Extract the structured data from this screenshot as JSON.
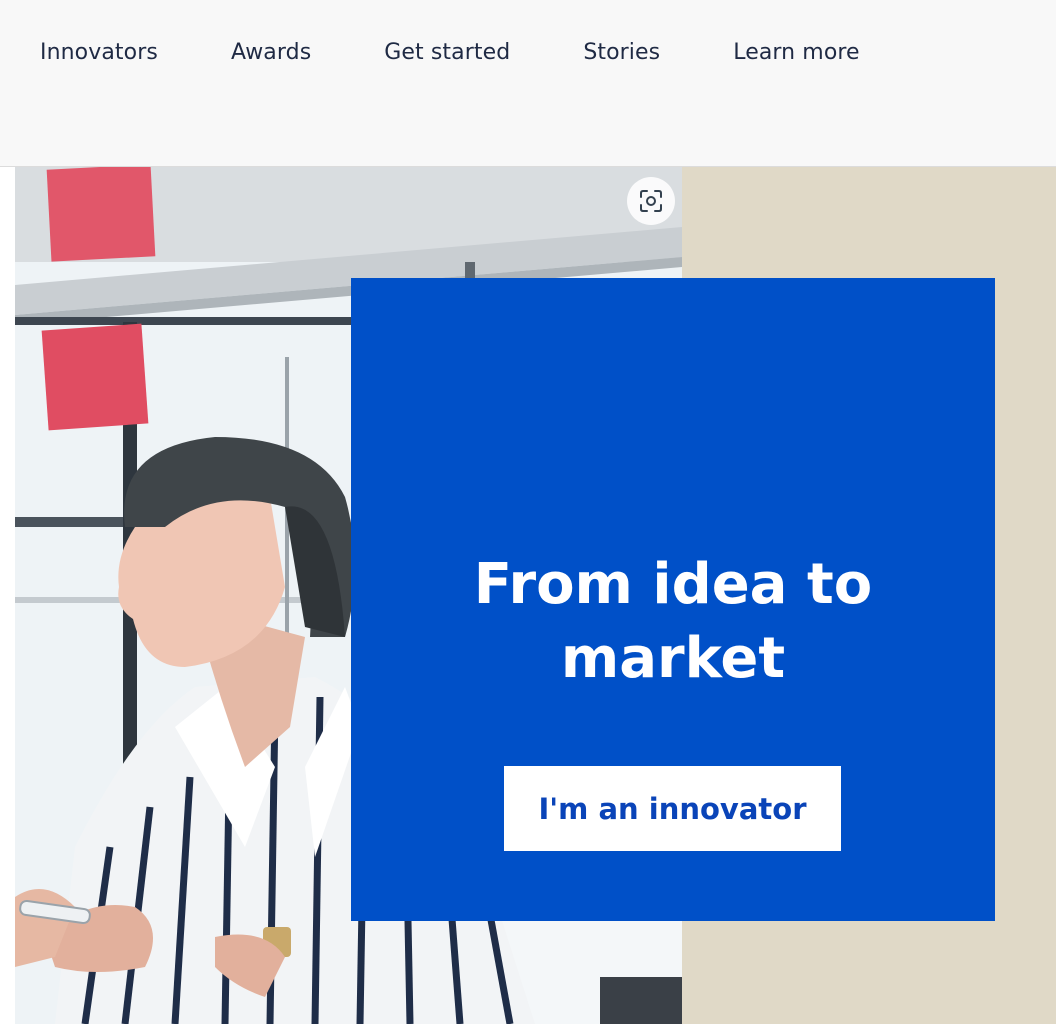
{
  "nav": {
    "items": [
      {
        "label": "Innovators"
      },
      {
        "label": "Awards"
      },
      {
        "label": "Get started"
      },
      {
        "label": "Stories"
      },
      {
        "label": "Learn more"
      }
    ]
  },
  "hero": {
    "title": "From idea to market",
    "cta_label": "I'm an innovator",
    "scan_icon": "visual-search-icon"
  },
  "colors": {
    "nav_bg": "#f8f8f8",
    "nav_text": "#1f2a44",
    "card_blue": "#0050c8",
    "beige": "#e0d9c7",
    "cta_text": "#0a44b8"
  }
}
